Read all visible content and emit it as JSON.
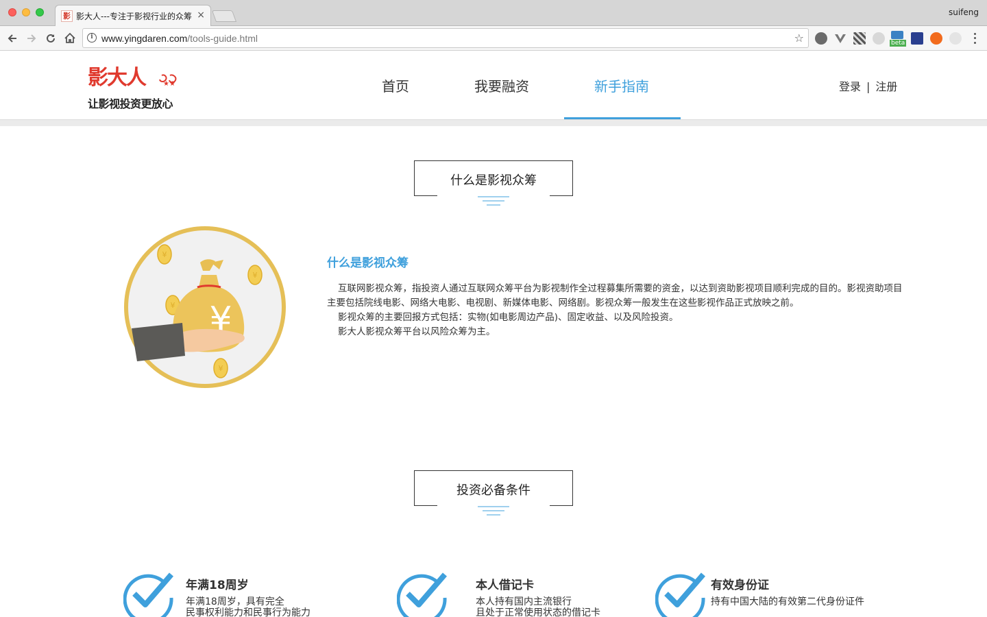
{
  "browser": {
    "tab_title": "影大人---专注于影视行业的众筹",
    "tab_favicon": "影",
    "tab_close": "×",
    "profile_name": "suifeng",
    "url_host": "www.yingdaren.com",
    "url_path": "/tools-guide.html",
    "extension_badge": "beta",
    "icons": [
      "back-icon",
      "forward-icon",
      "reload-icon",
      "home-icon",
      "info-icon",
      "star-icon",
      "menu-icon"
    ]
  },
  "header": {
    "logo_text": "影大人",
    "logo_tagline": "让影视投资更放心",
    "nav": [
      {
        "label": "首页",
        "active": false
      },
      {
        "label": "我要融资",
        "active": false
      },
      {
        "label": "新手指南",
        "active": true
      }
    ],
    "login": "登录",
    "separator": "|",
    "register": "注册",
    "accent_color": "#3fa0dc"
  },
  "intro": {
    "section_title": "什么是影视众筹",
    "heading": "什么是影视众筹",
    "paragraphs": [
      "互联网影视众筹，指投资人通过互联网众筹平台为影视制作全过程募集所需要的资金，以达到资助影视项目顺利完成的目的。影视资助项目主要包括院线电影、网络大电影、电视剧、新媒体电影、网络剧。影视众筹一般发生在这些影视作品正式放映之前。",
      "影视众筹的主要回报方式包括：实物(如电影周边产品)、固定收益、以及风险投资。",
      "影大人影视众筹平台以风险众筹为主。"
    ],
    "illustration_symbol": "¥"
  },
  "requirements": {
    "section_title": "投资必备条件",
    "items": [
      {
        "title": "年满18周岁",
        "desc": [
          "年满18周岁，具有完全",
          "民事权利能力和民事行为能力"
        ]
      },
      {
        "title": "本人借记卡",
        "desc": [
          "本人持有国内主流银行",
          "且处于正常使用状态的借记卡"
        ]
      },
      {
        "title": "有效身份证",
        "desc": [
          "持有中国大陆的有效第二代身份证件"
        ]
      }
    ]
  }
}
